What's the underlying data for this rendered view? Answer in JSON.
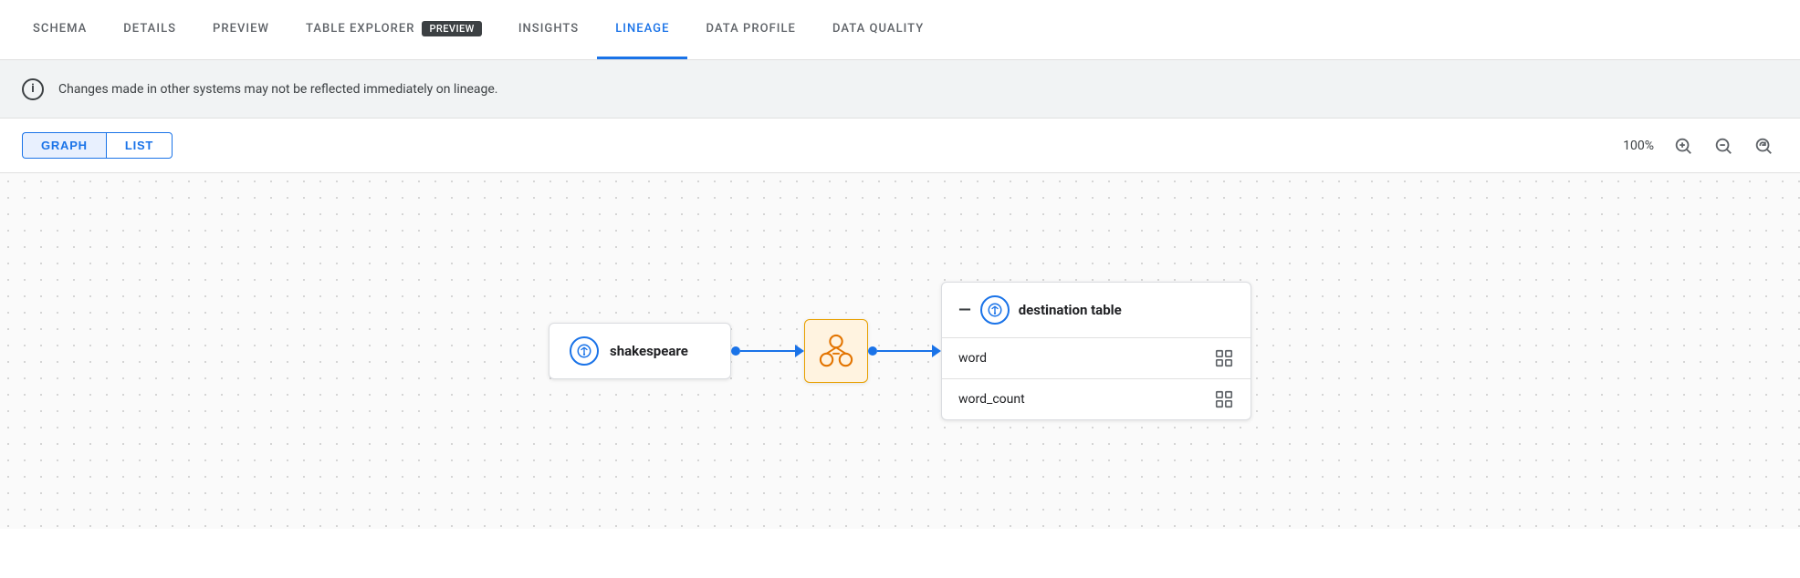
{
  "tabs": [
    {
      "id": "schema",
      "label": "SCHEMA",
      "active": false
    },
    {
      "id": "details",
      "label": "DETAILS",
      "active": false
    },
    {
      "id": "preview",
      "label": "PREVIEW",
      "active": false
    },
    {
      "id": "table-explorer",
      "label": "TABLE EXPLORER",
      "badge": "PREVIEW",
      "active": false
    },
    {
      "id": "insights",
      "label": "INSIGHTS",
      "active": false
    },
    {
      "id": "lineage",
      "label": "LINEAGE",
      "active": true
    },
    {
      "id": "data-profile",
      "label": "DATA PROFILE",
      "active": false
    },
    {
      "id": "data-quality",
      "label": "DATA QUALITY",
      "active": false
    }
  ],
  "info_bar": {
    "message": "Changes made in other systems may not be reflected immediately on lineage."
  },
  "toolbar": {
    "graph_label": "GRAPH",
    "list_label": "LIST",
    "zoom_pct": "100%"
  },
  "graph": {
    "source_node": {
      "label": "shakespeare"
    },
    "destination_node": {
      "label": "destination table",
      "fields": [
        {
          "name": "word"
        },
        {
          "name": "word_count"
        }
      ]
    }
  },
  "icons": {
    "info": "ℹ",
    "zoom_in": "⊕",
    "zoom_out": "⊖",
    "zoom_reset": "↺",
    "field_link": "⊞"
  },
  "colors": {
    "active_tab": "#1a73e8",
    "tab_border": "#1a73e8",
    "node_border": "#dadce0",
    "transform_bg": "#fff3e0",
    "transform_border": "#e8a000",
    "connector": "#1a73e8"
  }
}
